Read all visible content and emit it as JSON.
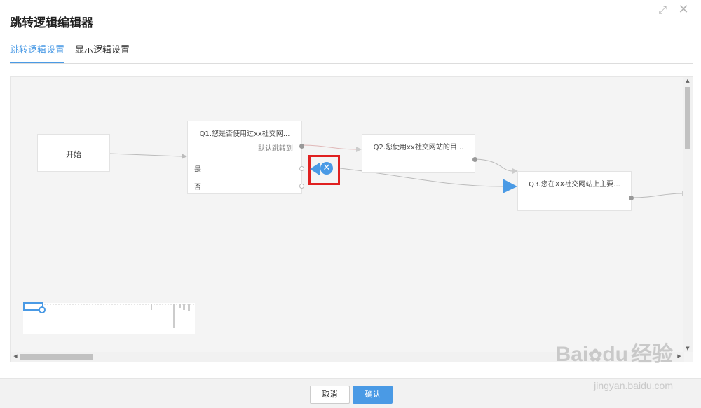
{
  "dialog": {
    "title": "跳转逻辑编辑器",
    "maximize_icon": "expand-icon",
    "close_icon": "close-icon"
  },
  "tabs": [
    {
      "label": "跳转逻辑设置",
      "active": true
    },
    {
      "label": "显示逻辑设置",
      "active": false
    }
  ],
  "canvas": {
    "start_node": {
      "label": "开始"
    },
    "q1": {
      "title": "Q1.您是否使用过xx社交网...",
      "default_label": "默认跳转到",
      "options": [
        "是",
        "否"
      ]
    },
    "q2": {
      "title": "Q2.您使用xx社交网站的目..."
    },
    "q3": {
      "title": "Q3.您在XX社交网站上主要..."
    }
  },
  "footer": {
    "cancel_label": "取消",
    "confirm_label": "确认"
  },
  "watermark": {
    "brand": "Bai",
    "brand2": "du",
    "brand_cn": "经验",
    "url": "jingyan.baidu.com"
  },
  "colors": {
    "accent": "#4a9ae5",
    "highlight": "#e02020"
  }
}
